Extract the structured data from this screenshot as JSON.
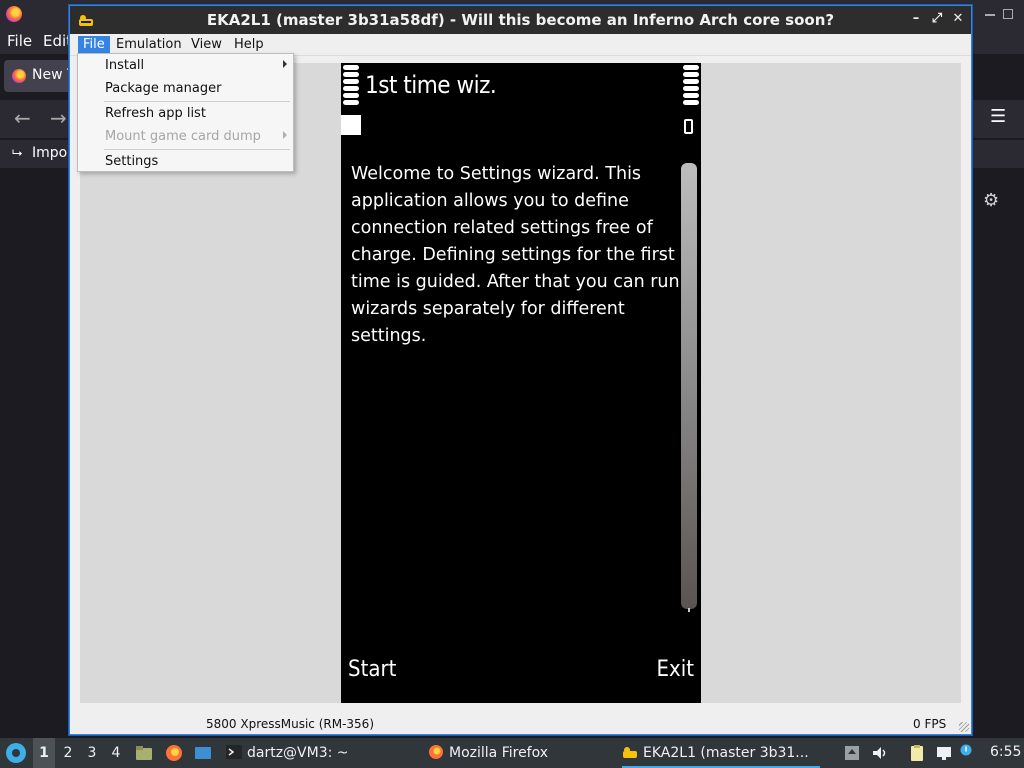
{
  "firefox": {
    "menu_file": "File",
    "menu_edit": "Edit",
    "tab_label": "New T",
    "back_icon": "←",
    "forward_icon": "→",
    "import_icon": "⮡",
    "import_label": "Impor",
    "menu_icon": "☰",
    "gear_icon": "⚙"
  },
  "window": {
    "title": "EKA2L1 (master 3b31a58df) - Will this become an Inferno Arch core soon?",
    "btn_min": "–",
    "btn_max": "⤢",
    "btn_close": "✕"
  },
  "menubar": {
    "file": "File",
    "emulation": "Emulation",
    "view": "View",
    "help": "Help"
  },
  "file_menu": {
    "install": "Install",
    "package_manager": "Package manager",
    "refresh_app_list": "Refresh app list",
    "mount_game_card_dump": "Mount game card dump",
    "settings": "Settings"
  },
  "phone": {
    "title": "1st time wiz.",
    "body": "Welcome to Settings wizard. This application allows you to define connection related settings free of charge. Defining settings for the first time is guided. After that you can run wizards separately for different settings.",
    "left_softkey": "Start",
    "right_softkey": "Exit"
  },
  "statusbar": {
    "device": "5800 XpressMusic (RM-356)",
    "fps": "0 FPS"
  },
  "taskbar": {
    "workspaces": [
      "1",
      "2",
      "3",
      "4"
    ],
    "active_workspace": "1",
    "terminal_task": "dartz@VM3: ~",
    "firefox_task": "Mozilla Firefox",
    "eka_task": "EKA2L1 (master 3b31...",
    "clock": "6:55"
  },
  "colors": {
    "accent": "#3584e4",
    "taskbar_bg": "#31363b",
    "titlebar_bg": "#2d2d2d",
    "phone_bg": "#000000"
  }
}
